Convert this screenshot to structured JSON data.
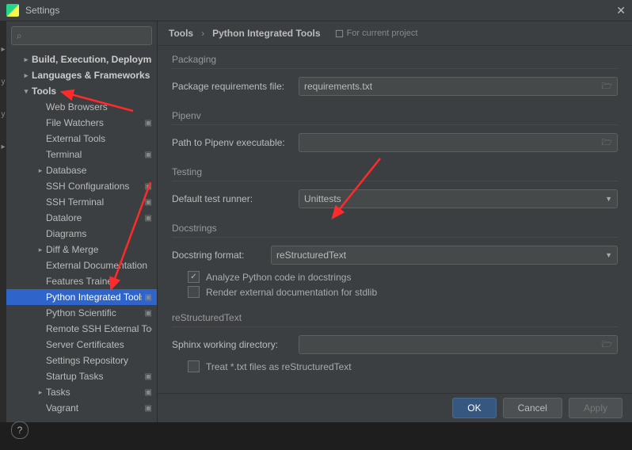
{
  "window": {
    "title": "Settings"
  },
  "search": {
    "placeholder": ""
  },
  "tree": {
    "topLevels": [
      {
        "label": "Build, Execution, Deployment",
        "expanded": false
      },
      {
        "label": "Languages & Frameworks",
        "expanded": false
      }
    ],
    "tools": {
      "label": "Tools",
      "children": [
        {
          "label": "Web Browsers",
          "override": false
        },
        {
          "label": "File Watchers",
          "override": true
        },
        {
          "label": "External Tools",
          "override": false
        },
        {
          "label": "Terminal",
          "override": true
        },
        {
          "label": "Database",
          "override": false,
          "expandable": true
        },
        {
          "label": "SSH Configurations",
          "override": true
        },
        {
          "label": "SSH Terminal",
          "override": true
        },
        {
          "label": "Datalore",
          "override": true
        },
        {
          "label": "Diagrams",
          "override": false
        },
        {
          "label": "Diff & Merge",
          "override": false,
          "expandable": true
        },
        {
          "label": "External Documentation",
          "override": false
        },
        {
          "label": "Features Trainer",
          "override": false
        },
        {
          "label": "Python Integrated Tools",
          "override": true,
          "selected": true
        },
        {
          "label": "Python Scientific",
          "override": true
        },
        {
          "label": "Remote SSH External Tools",
          "override": false
        },
        {
          "label": "Server Certificates",
          "override": false
        },
        {
          "label": "Settings Repository",
          "override": false
        },
        {
          "label": "Startup Tasks",
          "override": true
        },
        {
          "label": "Tasks",
          "override": true,
          "expandable": true
        },
        {
          "label": "Vagrant",
          "override": true
        }
      ]
    }
  },
  "breadcrumb": {
    "a": "Tools",
    "b": "Python Integrated Tools"
  },
  "scope": "For current project",
  "sections": {
    "packaging": {
      "title": "Packaging",
      "reqLabel": "Package requirements file:",
      "reqValue": "requirements.txt"
    },
    "pipenv": {
      "title": "Pipenv",
      "pathLabel": "Path to Pipenv executable:",
      "pathValue": ""
    },
    "testing": {
      "title": "Testing",
      "runnerLabel": "Default test runner:",
      "runnerValue": "Unittests"
    },
    "docstrings": {
      "title": "Docstrings",
      "formatLabel": "Docstring format:",
      "formatValue": "reStructuredText",
      "analyze": "Analyze Python code in docstrings",
      "renderExt": "Render external documentation for stdlib"
    },
    "rst": {
      "title": "reStructuredText",
      "sphinxLabel": "Sphinx working directory:",
      "sphinxValue": "",
      "treatTxt": "Treat *.txt files as reStructuredText"
    }
  },
  "buttons": {
    "ok": "OK",
    "cancel": "Cancel",
    "apply": "Apply"
  },
  "overrideGlyph": "▣"
}
